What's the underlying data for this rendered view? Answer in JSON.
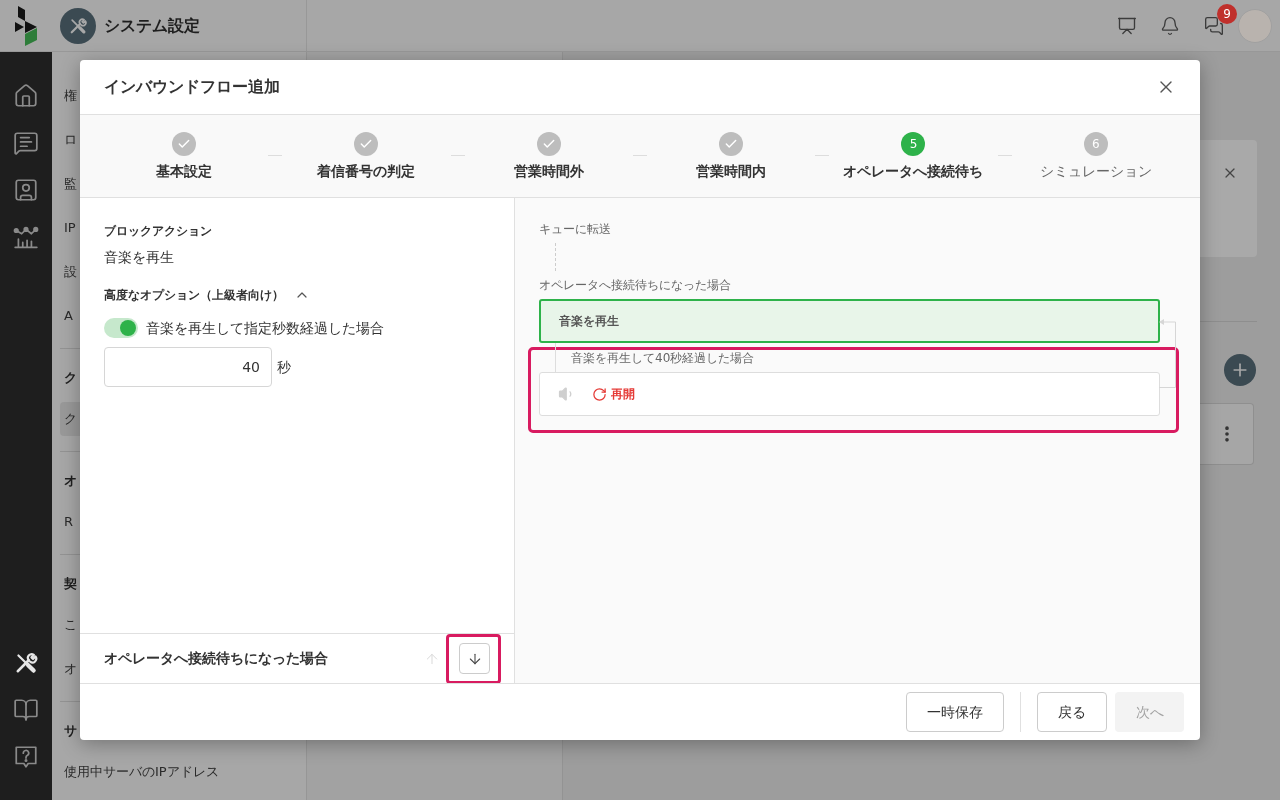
{
  "app_nav": {
    "top": [
      {
        "selected": false
      },
      {
        "selected": false
      },
      {
        "selected": false
      },
      {
        "selected": false
      }
    ],
    "bottom": [
      {
        "selected": true
      },
      {
        "selected": false
      },
      {
        "selected": false
      }
    ]
  },
  "header": {
    "title": "システム設定",
    "chat_badge": "9"
  },
  "settings_menu": [
    {
      "items": [
        {
          "label": "権",
          "selected": false
        },
        {
          "label": "ロ",
          "selected": false
        },
        {
          "label": "監",
          "selected": false
        },
        {
          "label": "IP",
          "selected": false
        },
        {
          "label": "設",
          "selected": false
        },
        {
          "label": "A",
          "selected": false
        }
      ]
    },
    {
      "heading": "ク",
      "items": [
        {
          "label": "ク",
          "selected": true
        }
      ]
    },
    {
      "heading": "オ",
      "items": [
        {
          "label": "R",
          "selected": false
        }
      ]
    },
    {
      "heading": "契",
      "items": [
        {
          "label": "こ",
          "selected": false
        },
        {
          "label": "オ",
          "selected": false
        }
      ]
    },
    {
      "heading": "サ",
      "items": [
        {
          "label": "使用中サーバのIPアドレス",
          "selected": false
        }
      ]
    }
  ],
  "dialog": {
    "title": "インバウンドフロー追加",
    "steps": [
      {
        "label": "基本設定",
        "completed": true,
        "selected": false
      },
      {
        "label": "着信番号の判定",
        "completed": true,
        "selected": false
      },
      {
        "label": "営業時間外",
        "completed": true,
        "selected": false
      },
      {
        "label": "営業時間内",
        "completed": true,
        "selected": false
      },
      {
        "number": "5",
        "label": "オペレータへ接続待ち",
        "completed": false,
        "selected": true
      },
      {
        "number": "6",
        "label": "シミュレーション",
        "completed": false,
        "selected": false
      }
    ],
    "block_action": {
      "label": "ブロックアクション",
      "value": "音楽を再生"
    },
    "advanced_options": {
      "label": "高度なオプション（上級者向け）",
      "expanded": true,
      "toggle": {
        "label": "音楽を再生して指定秒数経過した場合",
        "on": true
      },
      "seconds": {
        "value": "40",
        "unit": "秒"
      }
    },
    "section_nav": {
      "title": "オペレータへ接続待ちになった場合",
      "up": {
        "disabled": true
      },
      "down": {
        "disabled": false,
        "highlighted": true
      }
    },
    "flow": {
      "source": "キューに転送",
      "condition": "オペレータへ接続待ちになった場合",
      "block": {
        "label": "音楽を再生",
        "selected": true
      },
      "branch": {
        "label": "音楽を再生して40秒経過した場合",
        "highlighted": true,
        "action": "再開"
      }
    },
    "footer": {
      "groups": [
        [
          {
            "label": "一時保存",
            "disabled": false
          }
        ],
        [
          {
            "label": "戻る",
            "disabled": false
          },
          {
            "label": "次へ",
            "disabled": true
          }
        ]
      ]
    }
  }
}
